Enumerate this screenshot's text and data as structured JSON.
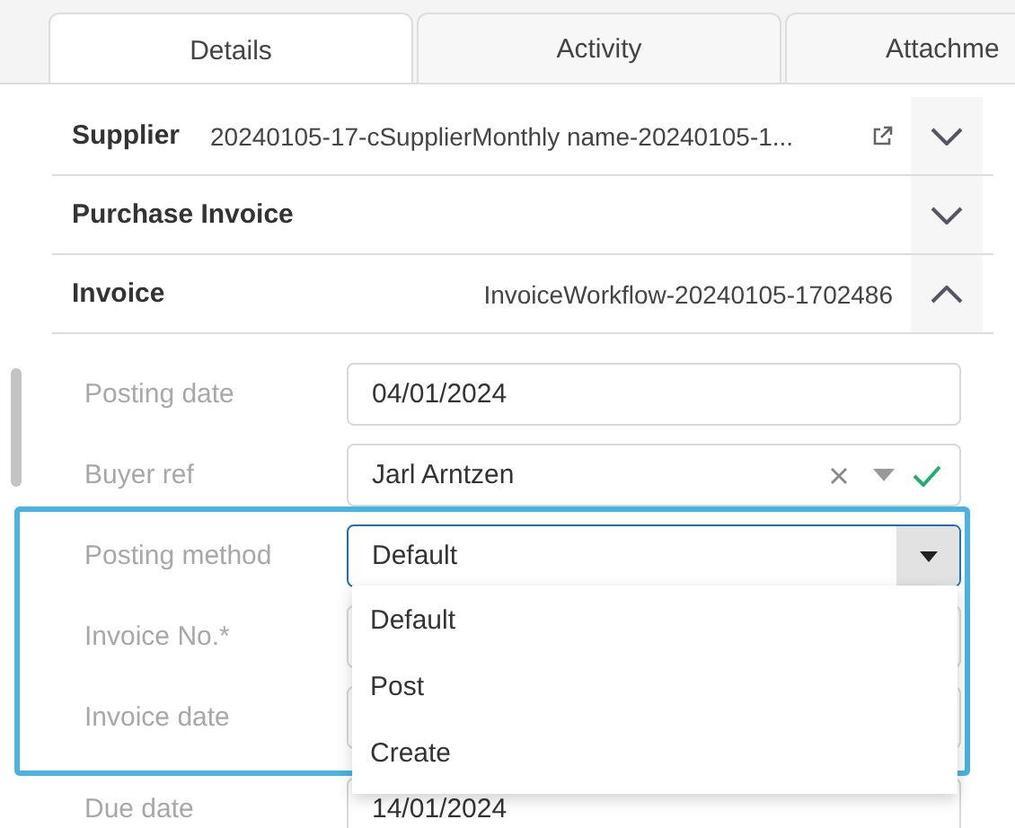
{
  "tabs": [
    {
      "label": "Details",
      "selected": true
    },
    {
      "label": "Activity",
      "selected": false
    },
    {
      "label": "Attachme",
      "selected": false
    }
  ],
  "sections": [
    {
      "title": "Supplier",
      "value": "20240105-17-cSupplierMonthly name-20240105-1...",
      "link": true,
      "expanded": false
    },
    {
      "title": "Purchase Invoice",
      "expanded": false
    },
    {
      "title": "Invoice",
      "value": "InvoiceWorkflow-20240105-1702486",
      "expanded": true
    }
  ],
  "fields": [
    {
      "label": "Posting date",
      "kind": "text",
      "value": "04/01/2024",
      "highlighted": false
    },
    {
      "label": "Buyer ref",
      "kind": "lookup",
      "value": "Jarl Arntzen",
      "valid": true,
      "highlighted": false
    },
    {
      "label": "Posting method",
      "kind": "select",
      "value": "Default",
      "open": true,
      "highlighted": true
    },
    {
      "label": "Invoice No.*",
      "kind": "text",
      "highlighted": true
    },
    {
      "label": "Invoice date",
      "kind": "text",
      "highlighted": true
    },
    {
      "label": "Due date",
      "kind": "text",
      "value": "14/01/2024",
      "highlighted": false
    }
  ],
  "dropdown": {
    "options": [
      "Default",
      "Post",
      "Create"
    ]
  }
}
